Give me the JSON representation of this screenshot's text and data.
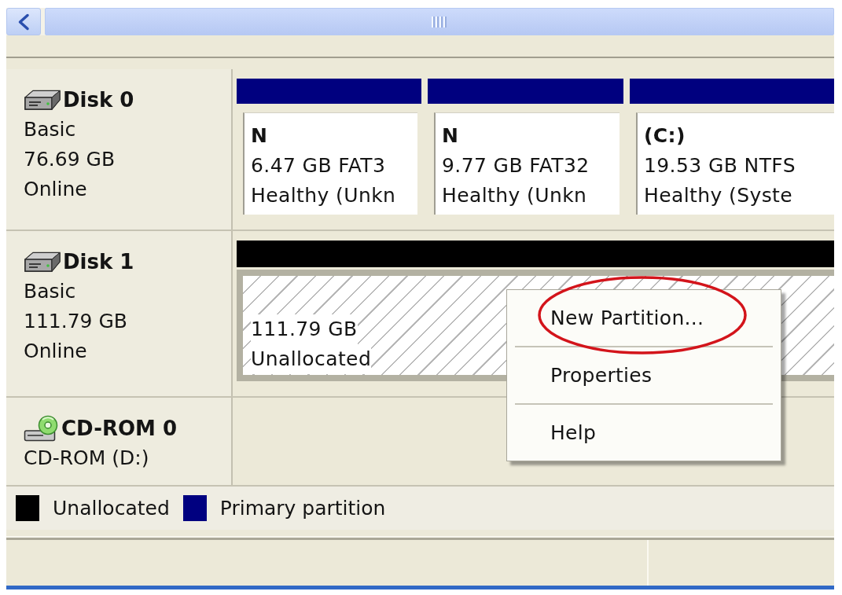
{
  "disks": [
    {
      "kind": "disk",
      "name": "Disk 0",
      "type": "Basic",
      "size": "76.69 GB",
      "status": "Online",
      "partitions": [
        {
          "kind": "primary",
          "label": "N",
          "size": "6.47 GB FAT3",
          "status": "Healthy (Unkn"
        },
        {
          "kind": "primary",
          "label": "N",
          "size": "9.77 GB FAT32",
          "status": "Healthy (Unkn"
        },
        {
          "kind": "primary",
          "label": "(C:)",
          "size": "19.53 GB NTFS",
          "status": "Healthy (Syste"
        }
      ]
    },
    {
      "kind": "disk",
      "name": "Disk 1",
      "type": "Basic",
      "size": "111.79 GB",
      "status": "Online",
      "partitions": [
        {
          "kind": "unallocated",
          "size": "111.79 GB",
          "status": "Unallocated"
        }
      ]
    },
    {
      "kind": "cdrom",
      "name": "CD-ROM 0",
      "type": "CD-ROM (D:)"
    }
  ],
  "legend": [
    {
      "label": "Unallocated",
      "color": "#000000"
    },
    {
      "label": "Primary partition",
      "color": "#000080"
    }
  ],
  "context_menu": {
    "items": [
      {
        "label": "New Partition...",
        "circled": true
      },
      {
        "label": "Properties",
        "circled": false
      },
      {
        "label": "Help",
        "circled": false
      }
    ]
  }
}
